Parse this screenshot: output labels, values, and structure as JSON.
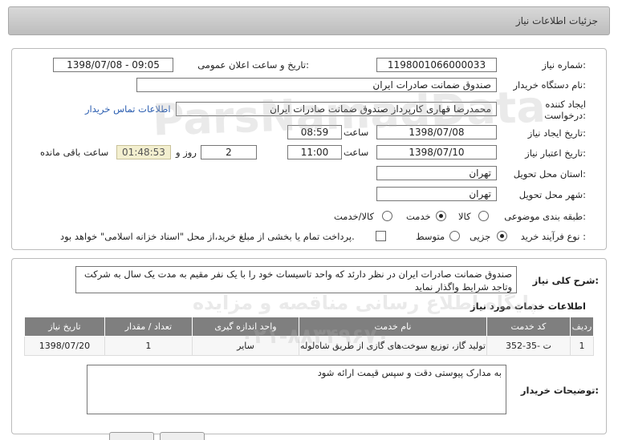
{
  "header": {
    "title": "جزئیات اطلاعات نیاز"
  },
  "info": {
    "need_number_label": "شماره نیاز:",
    "need_number": "1198001066000033",
    "announce_label": "تاریخ و ساعت اعلان عمومی:",
    "announce_value": "1398/07/08 - 09:05",
    "buyer_org_label": "نام دستگاه خریدار:",
    "buyer_org": "صندوق ضمانت صادرات ایران",
    "creator_label": "ایجاد کننده درخواست:",
    "creator": "محمدرضا قهاری کارپرداز صندوق ضمانت صادرات ایران",
    "contact_link": "اطلاعات تماس خریدار",
    "need_date_label": "تاریخ ایجاد نیاز:",
    "need_date": "1398/07/08",
    "time_label": "ساعت",
    "need_time": "08:59",
    "validity_label": "تاریخ اعتبار نیاز:",
    "validity_date": "1398/07/10",
    "validity_time": "11:00",
    "days": "2",
    "days_label": "روز و",
    "remaining": "01:48:53",
    "remaining_label": "ساعت باقی مانده",
    "province_label": "استان محل تحویل:",
    "province": "تهران",
    "city_label": "شهر محل تحویل:",
    "city": "تهران",
    "category_label": "طبقه بندی موضوعی:",
    "category_options": [
      "کالا",
      "خدمت",
      "کالا/خدمت"
    ],
    "category_selected": 1,
    "process_label": "نوع فرآیند خرید :",
    "process_options": [
      "جزیی",
      "متوسط"
    ],
    "process_selected": 0,
    "payment_note": "پرداخت تمام یا بخشی از مبلغ خرید،از محل \"اسناد خزانه اسلامی\" خواهد بود."
  },
  "summary": {
    "label": "شرح کلی نیاز:",
    "text": "صندوق ضمانت صادرات ایران در نظر دارئد که واحد تاسیسات خود را با یک نفر مقیم به مدت یک سال به شرکت وتاجد شرایط واگذار نماید",
    "services_title": "اطلاعات خدمات مورد نیاز"
  },
  "table": {
    "headers": [
      "ردیف",
      "کد خدمت",
      "نام خدمت",
      "واحد اندازه گیری",
      "تعداد / مقدار",
      "تاریخ نیاز"
    ],
    "rows": [
      [
        "1",
        "ت -35-352",
        "تولید گاز، توزیع سوخت‌های گازی از طریق شاه‌لوله",
        "سایر",
        "1",
        "1398/07/20"
      ]
    ]
  },
  "buyer_notes": {
    "label": "توضیحات خریدار:",
    "text": "به مدارک پیوستی دقت و سپس قیمت ارائه شود"
  },
  "watermark": {
    "line1": "ParsNamadData",
    "line2": "پایگاه اطلاع رسانی مناقصه و مزایده",
    "line3": "۰۲۱-۸۸۳۴۹۶۷۰"
  }
}
